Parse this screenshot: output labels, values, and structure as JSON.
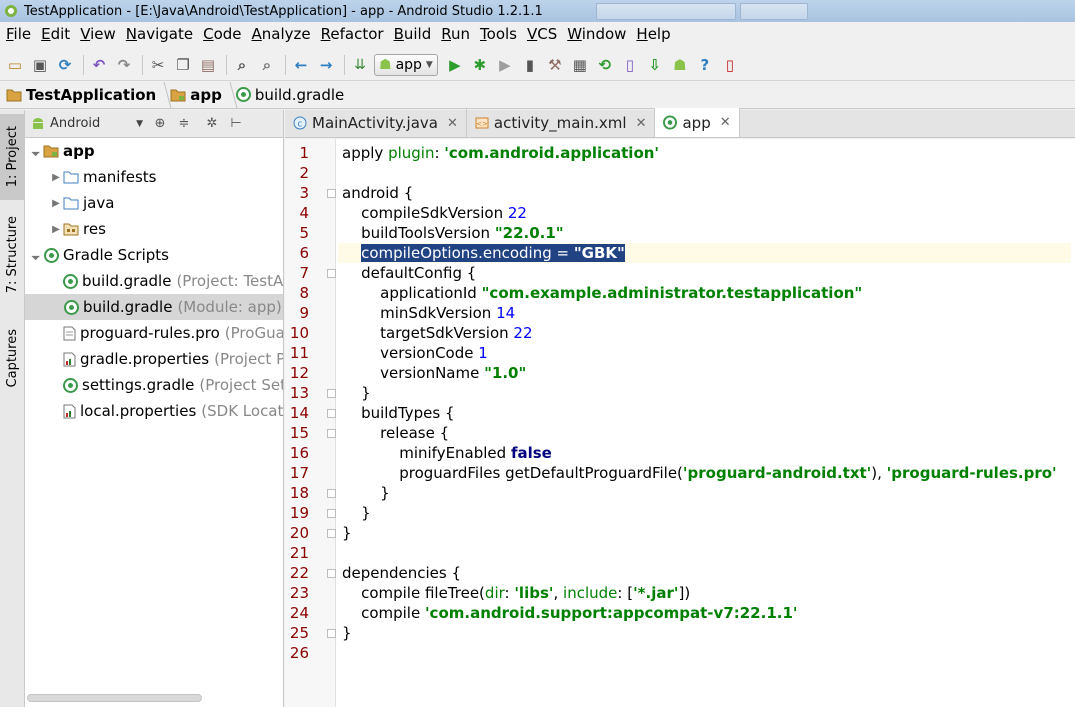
{
  "window": {
    "title": "TestApplication - [E:\\Java\\Android\\TestApplication] - app - Android Studio 1.2.1.1"
  },
  "menu": [
    "File",
    "Edit",
    "View",
    "Navigate",
    "Code",
    "Analyze",
    "Refactor",
    "Build",
    "Run",
    "Tools",
    "VCS",
    "Window",
    "Help"
  ],
  "toolbar": {
    "run_config": "app",
    "icons": [
      "open-icon",
      "save-icon",
      "sync-icon",
      "undo-icon",
      "redo-icon",
      "cut-icon",
      "copy-icon",
      "paste-icon",
      "find-icon",
      "replace-icon",
      "back-icon",
      "forward-icon",
      "make-icon",
      "run-icon",
      "debug-icon",
      "coverage-icon",
      "attach-debugger-icon",
      "project-structure-icon",
      "sdk-manager-icon",
      "gradle-sync-icon",
      "avd-manager-icon",
      "sdk-icon",
      "android-monitor-icon",
      "help-icon",
      "device-monitor-icon"
    ]
  },
  "breadcrumb": [
    "TestApplication",
    "app",
    "build.gradle"
  ],
  "left_strip": [
    "1: Project",
    "7: Structure",
    "Captures"
  ],
  "project_panel": {
    "view": "Android",
    "tree": [
      {
        "label": "app",
        "hint": "",
        "icon": "module-folder-icon",
        "expanded": true,
        "bold": true
      },
      {
        "label": "manifests",
        "hint": "",
        "icon": "folder-icon"
      },
      {
        "label": "java",
        "hint": "",
        "icon": "folder-icon"
      },
      {
        "label": "res",
        "hint": "",
        "icon": "res-folder-icon"
      },
      {
        "label": "Gradle Scripts",
        "hint": "",
        "icon": "gradle-icon",
        "expanded": true
      },
      {
        "label": "build.gradle",
        "hint": "(Project: TestAp",
        "icon": "gradle-icon"
      },
      {
        "label": "build.gradle",
        "hint": "(Module: app)",
        "icon": "gradle-icon",
        "selected": true
      },
      {
        "label": "proguard-rules.pro",
        "hint": "(ProGuar",
        "icon": "file-icon"
      },
      {
        "label": "gradle.properties",
        "hint": "(Project Pr",
        "icon": "properties-icon"
      },
      {
        "label": "settings.gradle",
        "hint": "(Project Setti",
        "icon": "gradle-icon"
      },
      {
        "label": "local.properties",
        "hint": "(SDK Locatio",
        "icon": "properties-icon"
      }
    ]
  },
  "editor_tabs": [
    {
      "label": "MainActivity.java",
      "icon": "java-class-icon"
    },
    {
      "label": "activity_main.xml",
      "icon": "xml-icon"
    },
    {
      "label": "app",
      "icon": "gradle-icon",
      "active": true
    }
  ],
  "editor": {
    "line_numbers": [
      "1",
      "2",
      "3",
      "4",
      "5",
      "6",
      "7",
      "8",
      "9",
      "10",
      "11",
      "12",
      "13",
      "14",
      "15",
      "16",
      "17",
      "18",
      "19",
      "20",
      "21",
      "22",
      "23",
      "24",
      "25",
      "26"
    ],
    "current_line": 6,
    "lines": [
      [
        [
          "t",
          "apply "
        ],
        [
          "pl",
          "plugin"
        ],
        [
          "t",
          ": "
        ],
        [
          "str",
          "'com.android.application'"
        ]
      ],
      [],
      [
        [
          "t",
          "android {"
        ]
      ],
      [
        [
          "t",
          "    compileSdkVersion "
        ],
        [
          "num",
          "22"
        ]
      ],
      [
        [
          "t",
          "    buildToolsVersion "
        ],
        [
          "str",
          "\"22.0.1\""
        ]
      ],
      [
        [
          "t",
          "    "
        ],
        [
          "sel",
          "compileOptions.encoding = "
        ],
        [
          "selstr",
          "\"GBK\""
        ]
      ],
      [
        [
          "t",
          "    defaultConfig {"
        ]
      ],
      [
        [
          "t",
          "        applicationId "
        ],
        [
          "str",
          "\"com.example.administrator.testapplication\""
        ]
      ],
      [
        [
          "t",
          "        minSdkVersion "
        ],
        [
          "num",
          "14"
        ]
      ],
      [
        [
          "t",
          "        targetSdkVersion "
        ],
        [
          "num",
          "22"
        ]
      ],
      [
        [
          "t",
          "        versionCode "
        ],
        [
          "num",
          "1"
        ]
      ],
      [
        [
          "t",
          "        versionName "
        ],
        [
          "str",
          "\"1.0\""
        ]
      ],
      [
        [
          "t",
          "    }"
        ]
      ],
      [
        [
          "t",
          "    buildTypes {"
        ]
      ],
      [
        [
          "t",
          "        release {"
        ]
      ],
      [
        [
          "t",
          "            minifyEnabled "
        ],
        [
          "kw",
          "false"
        ]
      ],
      [
        [
          "t",
          "            proguardFiles getDefaultProguardFile("
        ],
        [
          "str",
          "'proguard-android.txt'"
        ],
        [
          "t",
          "), "
        ],
        [
          "str",
          "'proguard-rules.pro'"
        ]
      ],
      [
        [
          "t",
          "        }"
        ]
      ],
      [
        [
          "t",
          "    }"
        ]
      ],
      [
        [
          "t",
          "}"
        ]
      ],
      [],
      [
        [
          "t",
          "dependencies {"
        ]
      ],
      [
        [
          "t",
          "    compile fileTree("
        ],
        [
          "pl",
          "dir"
        ],
        [
          "t",
          ": "
        ],
        [
          "str",
          "'libs'"
        ],
        [
          "t",
          ", "
        ],
        [
          "pl",
          "include"
        ],
        [
          "t",
          ": ["
        ],
        [
          "str",
          "'*.jar'"
        ],
        [
          "t",
          "])"
        ]
      ],
      [
        [
          "t",
          "    compile "
        ],
        [
          "str",
          "'com.android.support:appcompat-v7:22.1.1'"
        ]
      ],
      [
        [
          "t",
          "}"
        ]
      ],
      []
    ]
  },
  "colors": {
    "selection": "#214283",
    "string": "#008000",
    "number": "#0000ff",
    "keyword": "#000080",
    "line_number": "#8b0000"
  }
}
